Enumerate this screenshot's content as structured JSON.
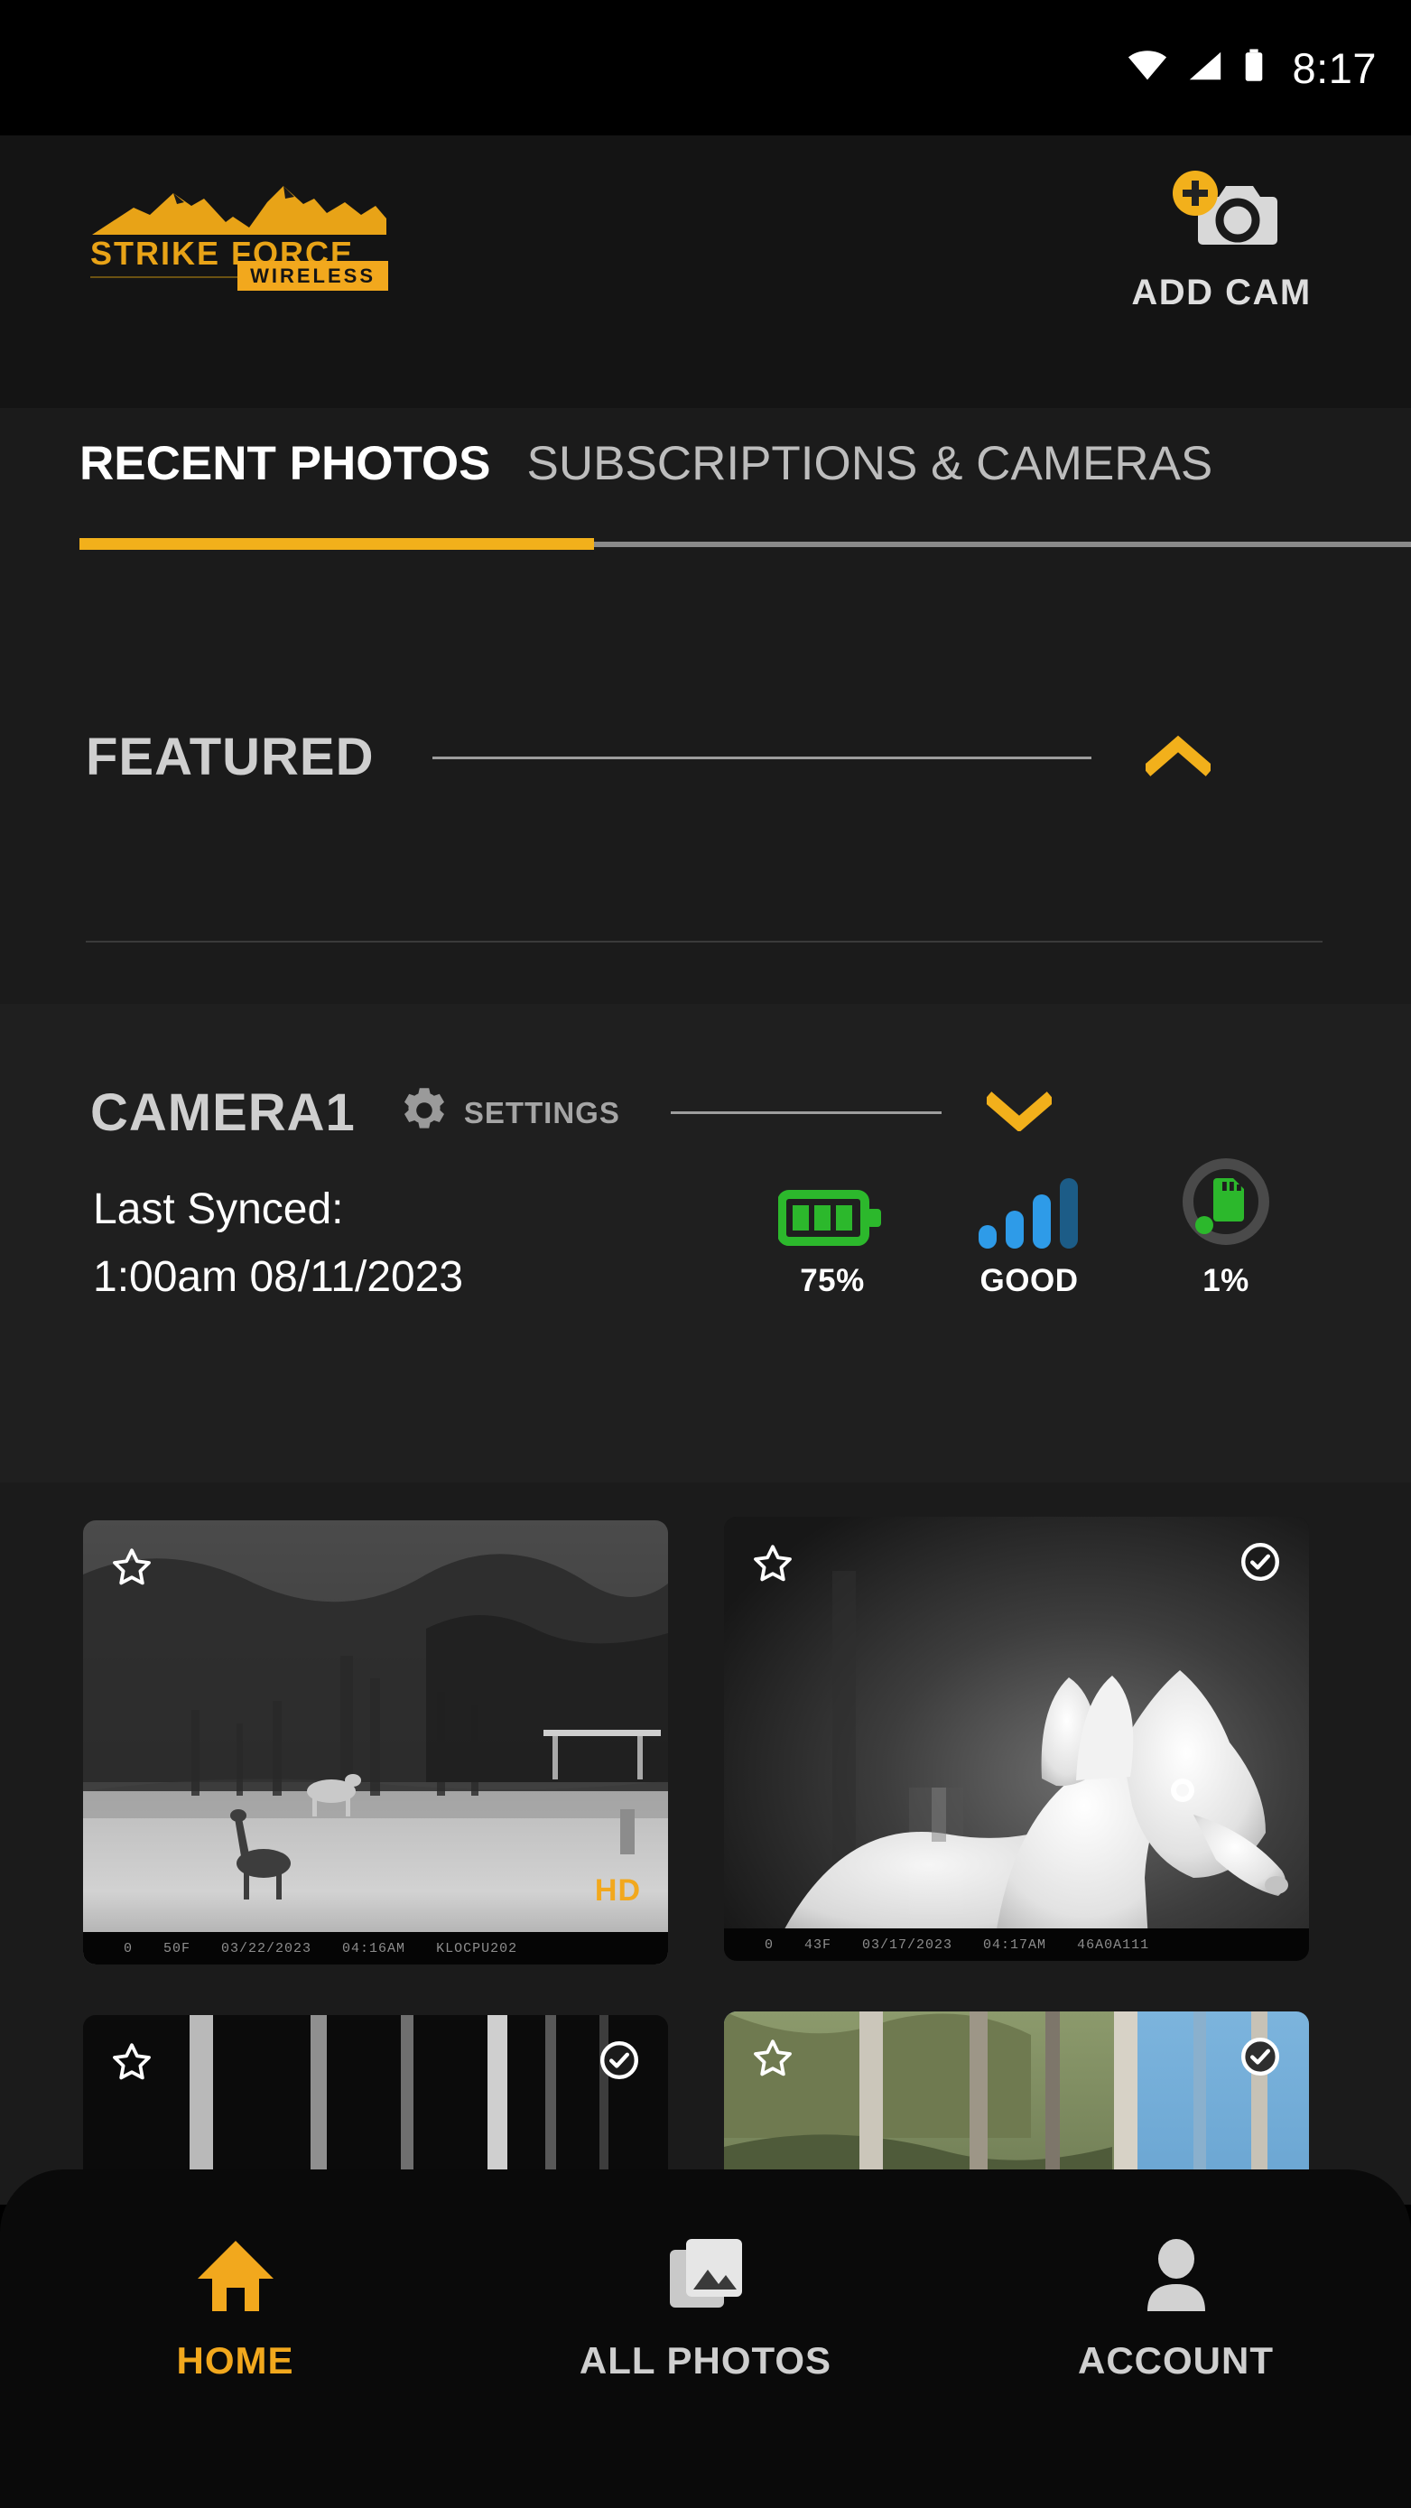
{
  "status_bar": {
    "time": "8:17",
    "icons": [
      "wifi-icon",
      "cellular-signal-icon",
      "battery-icon"
    ]
  },
  "header": {
    "logo": {
      "brand_line1": "STRIKE FORCE",
      "brand_line2": "WIRELESS",
      "icon": "mountains-icon",
      "color": "#E8A317"
    },
    "add_cam": {
      "label": "ADD CAM",
      "icon": "add-camera-icon",
      "badge_color": "#F2B01B"
    }
  },
  "tabs": {
    "items": [
      {
        "label": "RECENT PHOTOS",
        "active": true
      },
      {
        "label": "SUBSCRIPTIONS & CAMERAS",
        "active": false
      }
    ],
    "active_indicator_color": "#F2B01B"
  },
  "featured": {
    "title": "FEATURED",
    "toggle_icon": "chevron-up-icon",
    "toggle_color": "#F2B01B",
    "expanded": true
  },
  "camera": {
    "name": "CAMERA1",
    "settings_label": "SETTINGS",
    "settings_icon": "gear-icon",
    "toggle_icon": "chevron-down-icon",
    "toggle_color": "#F2B01B",
    "last_synced_label": "Last Synced:",
    "last_synced_value": "1:00am 08/11/2023",
    "stats": [
      {
        "name": "battery",
        "icon": "battery-icon",
        "value": "75%",
        "color": "#2CB82C"
      },
      {
        "name": "signal",
        "icon": "signal-bars-icon",
        "value": "GOOD",
        "color": "#2E9BE8"
      },
      {
        "name": "sd-card",
        "icon": "sd-card-icon",
        "value": "1%",
        "color": "#2CB82C"
      }
    ]
  },
  "photos": [
    {
      "id": "photo-1",
      "scene": "night-field-deer",
      "favorited": false,
      "selected": false,
      "quality_badge": "HD",
      "info": [
        "0",
        "50F",
        "03/22/2023",
        "04:16AM",
        "KLOCPU202"
      ]
    },
    {
      "id": "photo-2",
      "scene": "night-deer-closeup",
      "favorited": false,
      "selected": true,
      "quality_badge": "",
      "info": [
        "0",
        "43F",
        "03/17/2023",
        "04:17AM",
        "46A0A111"
      ]
    },
    {
      "id": "photo-3",
      "scene": "night-woods-dark",
      "favorited": false,
      "selected": true,
      "quality_badge": "",
      "info": []
    },
    {
      "id": "photo-4",
      "scene": "day-woods-sky",
      "favorited": false,
      "selected": true,
      "quality_badge": "",
      "info": []
    }
  ],
  "bottom_nav": {
    "items": [
      {
        "label": "HOME",
        "icon": "home-icon",
        "active": true
      },
      {
        "label": "ALL PHOTOS",
        "icon": "photo-stack-icon",
        "active": false
      },
      {
        "label": "ACCOUNT",
        "icon": "person-icon",
        "active": false
      }
    ],
    "active_color": "#F2A81D"
  }
}
